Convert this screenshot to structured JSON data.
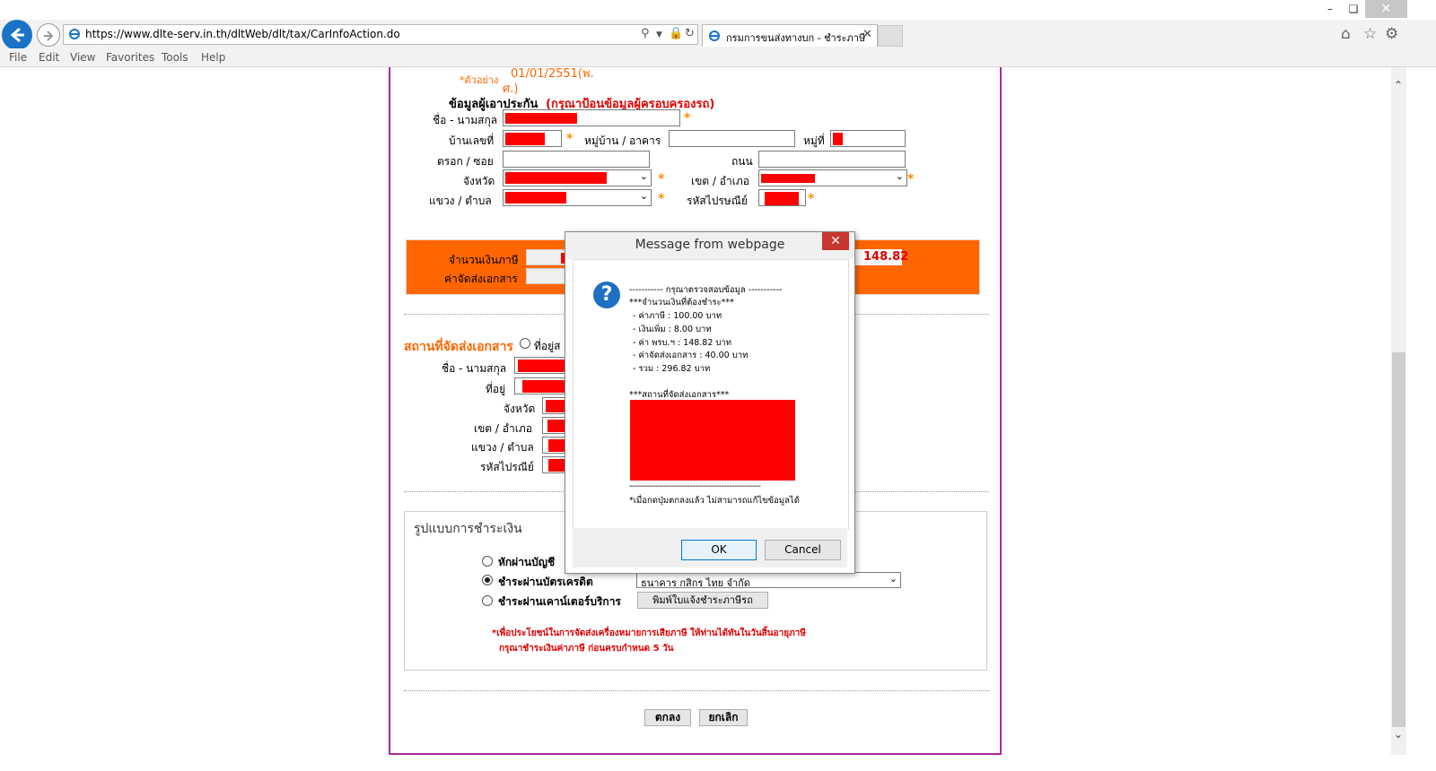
{
  "browser": {
    "url_prefix": "https://www.",
    "url_host": "dlte-serv.in.th",
    "url_path": "/dltWeb/dlt/tax/CarInfoAction.do",
    "tab_title": "กรมการขนส่งทางบก - ชำระภาษี",
    "menu": [
      "File",
      "Edit",
      "View",
      "Favorites",
      "Tools",
      "Help"
    ]
  },
  "form": {
    "example_label": "*ตัวอย่าง",
    "example_date": "01/01/2551(พ.",
    "example_date2": "ศ.)",
    "insured_heading": "ข้อมูลผู้เอาประกัน",
    "insured_hint": "(กรุณาป้อนข้อมูลผู้ครอบครองรถ)",
    "name_label": "ชื่อ - นามสกุล",
    "house_no_label": "บ้านเลขที่",
    "village_label": "หมู่บ้าน / อาคาร",
    "moo_label": "หมู่ที่",
    "alley_label": "ตรอก / ซอย",
    "road_label": "ถนน",
    "province_label": "จังหวัด",
    "district_label": "เขต / อำเภอ",
    "subdistrict_label": "แขวง / ตำบล",
    "postcode_label": "รหัสไปรษณีย์",
    "required_star": "*"
  },
  "tax_summary": {
    "tax_amount_label": "จำนวนเงินภาษี",
    "delivery_fee_label": "ค่าจัดส่งเอกสาร",
    "prb_value": "148.82"
  },
  "delivery": {
    "heading": "สถานที่จัดส่งเอกสาร",
    "radio_label": "ที่อยู่ส",
    "name_label": "ชื่อ - นามสกุล",
    "address_label": "ที่อยู่",
    "province_label": "จังหวัด",
    "district_label": "เขต / อำเภอ",
    "subdistrict_label": "แขวง / ตำบล",
    "postcode_label": "รหัสไปรณีย์"
  },
  "payment": {
    "heading": "รูปแบบการชำระเงิน",
    "option1": "หักผ่านบัญชี",
    "option2": "ชำระผ่านบัตรเครดิต",
    "option3": "ชำระผ่านเคาน์เตอร์บริการ",
    "bank_selected": "ธนาคาร กสิกร ไทย จำกัด",
    "print_button": "พิมพ์ใบแจ้งชำระภาษีรถ",
    "note1": "*เพื่อประโยชน์ในการจัดส่งเครื่องหมายการเสียภาษี ให้ท่านได้ทันในวันสิ้นอายุภาษี",
    "note2": "กรุณาชำระเงินค่าภาษี ก่อนครบกำหนด 5 วัน"
  },
  "actions": {
    "submit": "ตกลง",
    "cancel": "ยกเลิก"
  },
  "dialog": {
    "title": "Message from webpage",
    "header": "----------- กรุณาตรวจสอบข้อมูล -----------",
    "amount_heading": "***จำนวนเงินที่ต้องชำระ***",
    "lines": [
      "- ค่าภาษี : 100.00 บาท",
      "- เงินเพิ่ม : 8.00 บาท",
      "- ค่า พรบ.ฯ : 148.82 บาท",
      "- ค่าจัดส่งเอกสาร : 40.00 บาท",
      "- รวม : 296.82 บาท"
    ],
    "address_heading": "***สถานที่จัดส่งเอกสาร***",
    "footer_line": "--------------------------------------------------",
    "warning": "*เมื่อกดปุ่มตกลงแล้ว ไม่สามารถแก้ไขข้อมูลได้",
    "ok": "OK",
    "cancel": "Cancel"
  },
  "colors": {
    "accent_orange": "#ff6600",
    "redaction": "#ff0000",
    "frame": "#a52a9b",
    "ie_blue": "#1a73c7"
  }
}
